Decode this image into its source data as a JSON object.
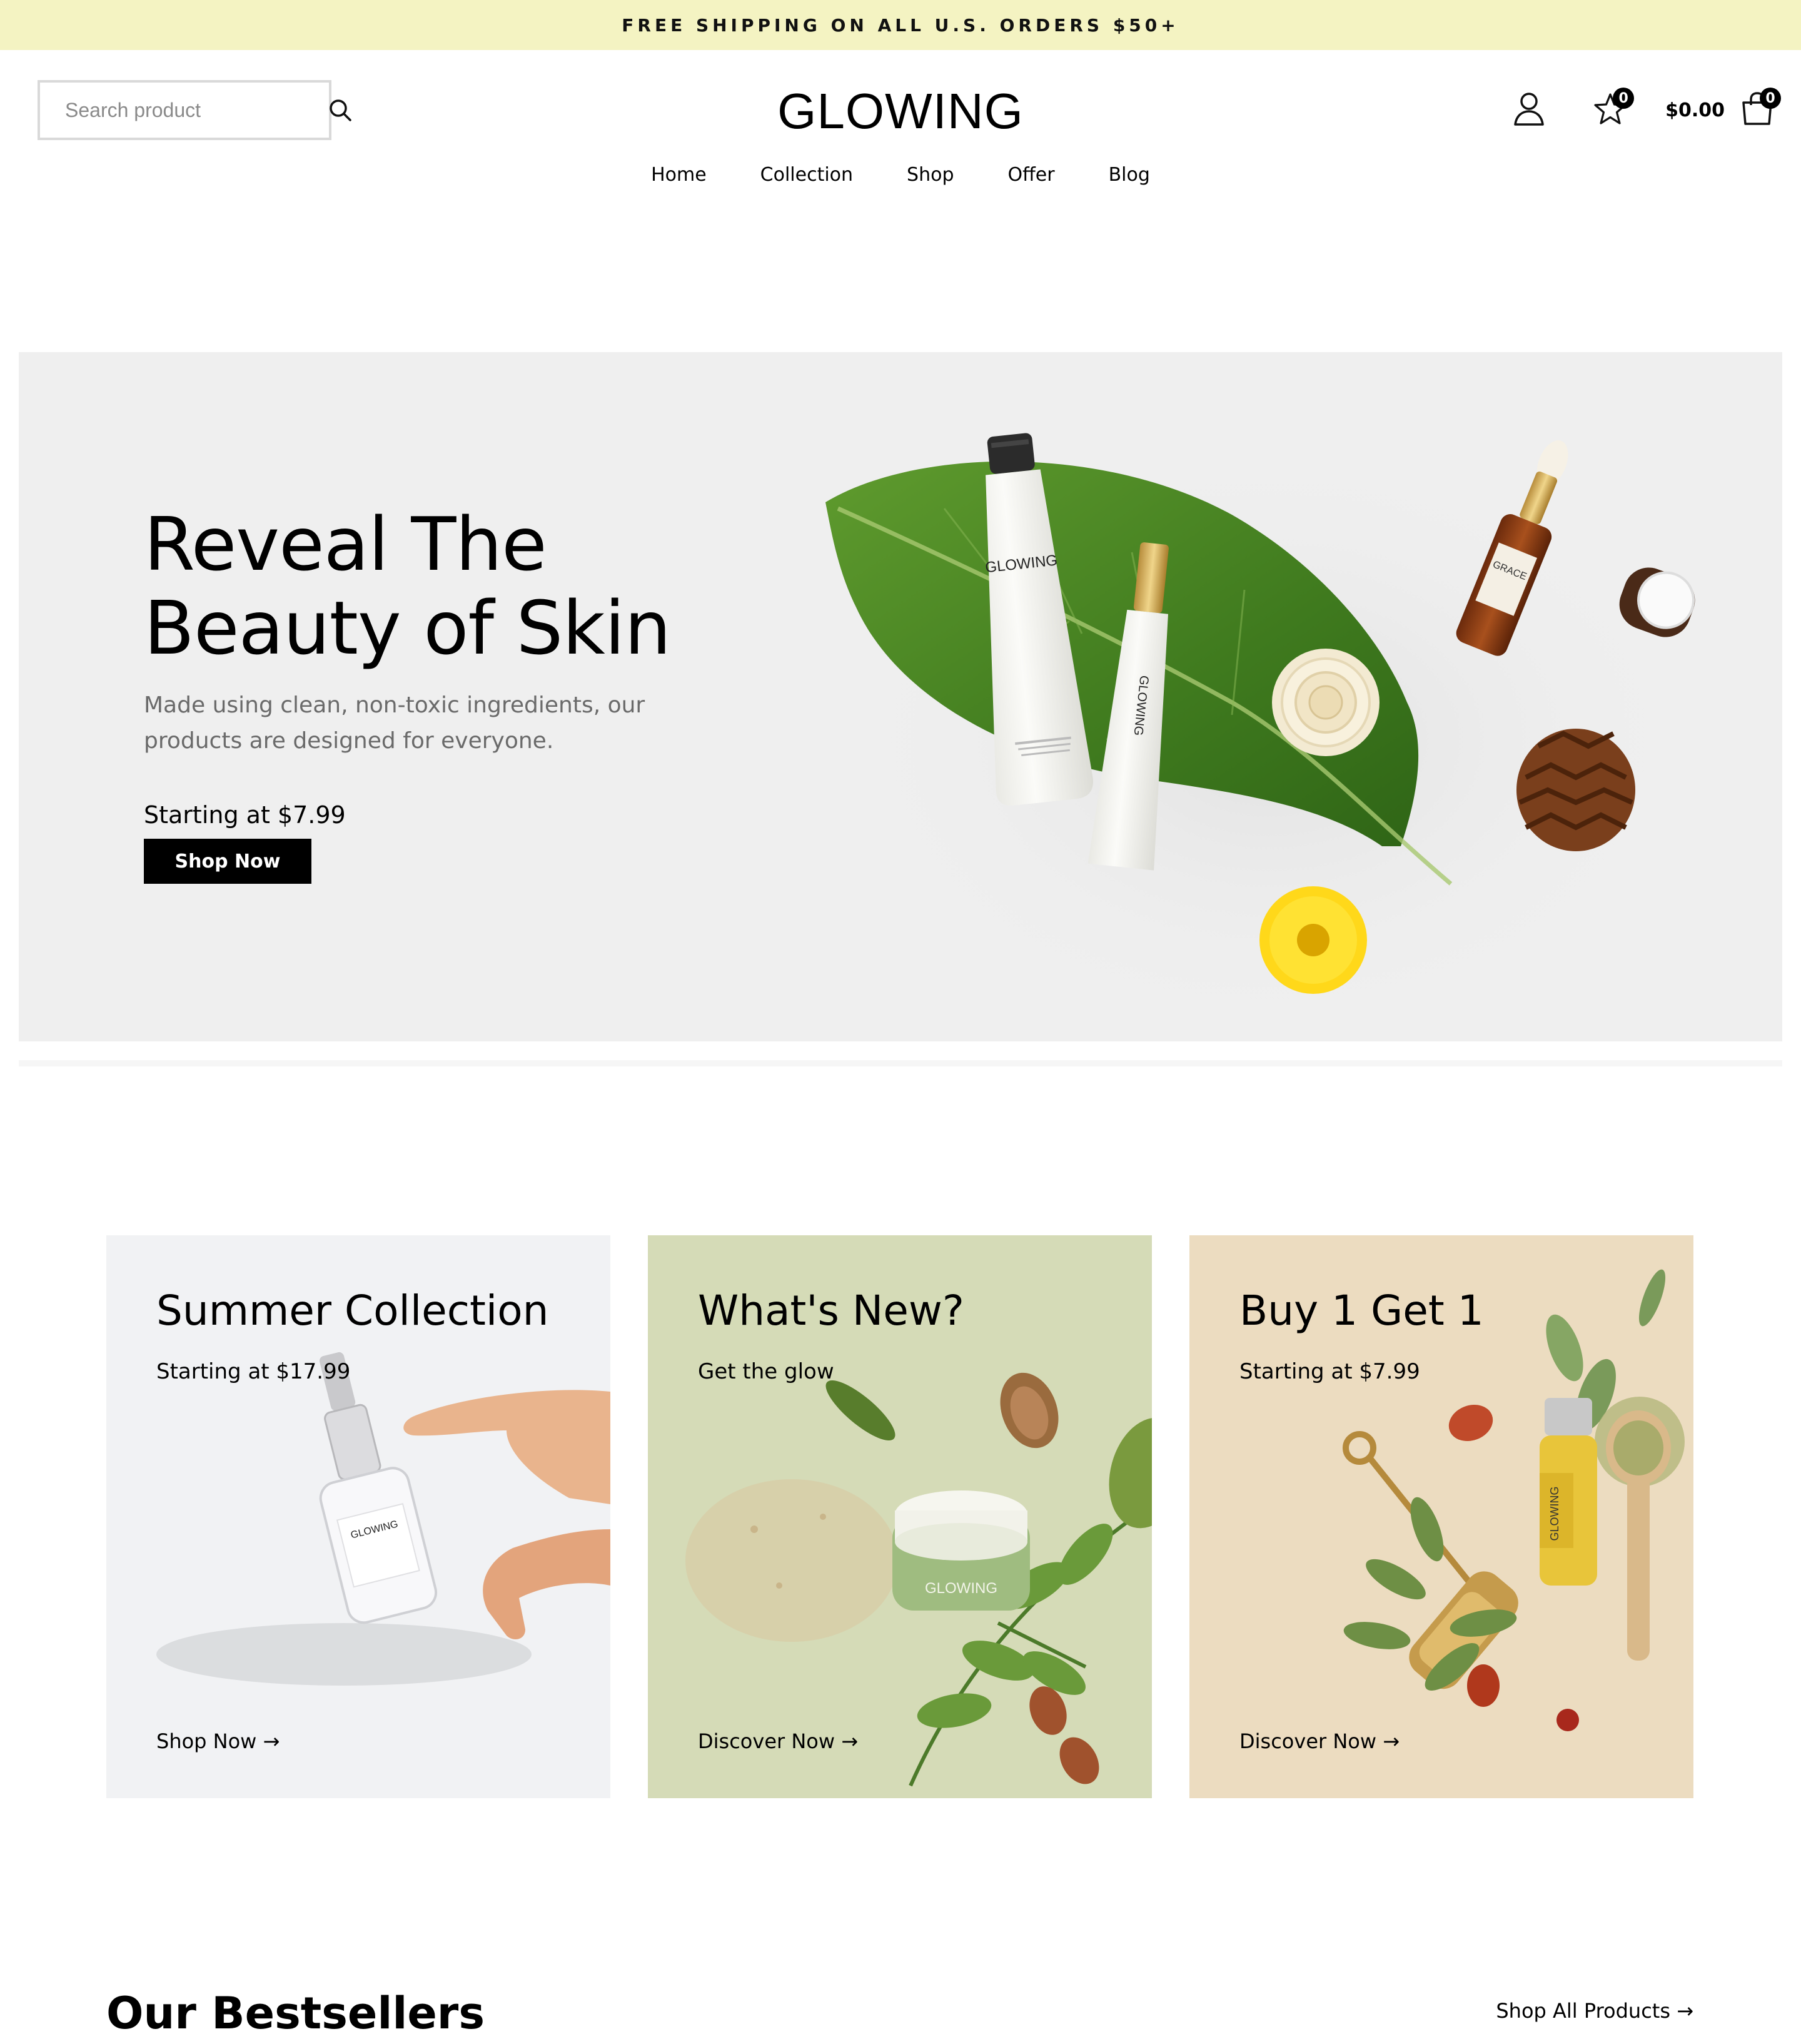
{
  "announcement": {
    "text": "FREE SHIPPING ON ALL U.S. ORDERS $50+"
  },
  "header": {
    "search_placeholder": "Search product",
    "logo": "GLOWING",
    "wishlist_count": "0",
    "cart_total": "$0.00",
    "cart_count": "0"
  },
  "nav": {
    "items": [
      {
        "label": "Home"
      },
      {
        "label": "Collection"
      },
      {
        "label": "Shop"
      },
      {
        "label": "Offer"
      },
      {
        "label": "Blog"
      }
    ]
  },
  "hero": {
    "title_line1": "Reveal The",
    "title_line2": "Beauty of Skin",
    "subtitle": "Made using clean, non-toxic ingredients, our products are designed for everyone.",
    "price": "Starting at $7.99",
    "button": "Shop Now",
    "product_labels": {
      "tube": "GLOWING",
      "small_tube": "GLOWING",
      "dropper": "GRACE"
    }
  },
  "cards": [
    {
      "title": "Summer Collection",
      "subtitle": "Starting at $17.99",
      "link": "Shop Now →",
      "bg": "#f1f2f4",
      "product_label": "GLOWING"
    },
    {
      "title": "What's New?",
      "subtitle": "Get the glow",
      "link": "Discover Now →",
      "bg": "#d5dbb7",
      "product_label": "GLOWING"
    },
    {
      "title": "Buy 1 Get 1",
      "subtitle": "Starting at $7.99",
      "link": "Discover Now →",
      "bg": "#ecdcc0",
      "product_label": "GLOWING"
    }
  ],
  "bestsellers": {
    "title": "Our Bestsellers",
    "link": "Shop All Products →"
  },
  "icons": {
    "search": "search-icon",
    "user": "user-icon",
    "wishlist": "star-icon",
    "cart": "shopping-bag-icon"
  },
  "colors": {
    "announcement_bg": "#f4f3c2",
    "hero_bg": "#efefef",
    "button_bg": "#000000",
    "accent_text": "#000000"
  }
}
